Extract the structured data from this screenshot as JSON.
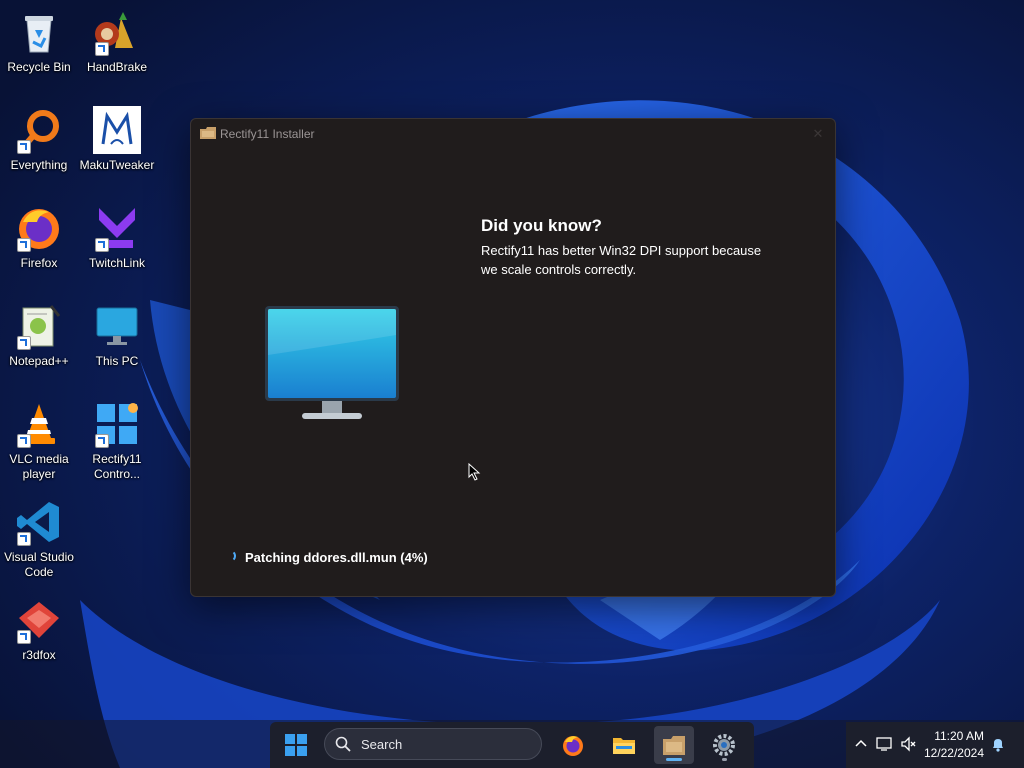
{
  "desktop": {
    "icons": [
      {
        "label": "Recycle Bin",
        "icon": "recycle-bin-icon"
      },
      {
        "label": "HandBrake",
        "icon": "handbrake-icon"
      },
      {
        "label": "Everything",
        "icon": "everything-icon"
      },
      {
        "label": "MakuTweaker",
        "icon": "makutweaker-icon"
      },
      {
        "label": "Firefox",
        "icon": "firefox-icon"
      },
      {
        "label": "TwitchLink",
        "icon": "twitchlink-icon"
      },
      {
        "label": "Notepad++",
        "icon": "notepadpp-icon"
      },
      {
        "label": "This PC",
        "icon": "this-pc-icon"
      },
      {
        "label": "VLC media player",
        "icon": "vlc-icon"
      },
      {
        "label": "Rectify11 Contro...",
        "icon": "rectify11-control-icon"
      },
      {
        "label": "Visual Studio Code",
        "icon": "vscode-icon"
      },
      {
        "label": "r3dfox",
        "icon": "r3dfox-icon"
      }
    ]
  },
  "installer": {
    "title": "Rectify11 Installer",
    "tip_title": "Did you know?",
    "tip_body": "Rectify11 has better Win32 DPI support because we scale controls correctly.",
    "status": "Patching ddores.dll.mun (4%)",
    "progress_percent": 4,
    "close_icon": "close-icon"
  },
  "taskbar": {
    "search_placeholder": "Search",
    "apps": [
      "start-icon",
      "firefox-icon",
      "file-explorer-icon",
      "rectify11-installer-icon",
      "settings-icon"
    ],
    "active_app": "rectify11-installer-icon"
  },
  "tray": {
    "time": "11:20 AM",
    "date": "12/22/2024",
    "icons": [
      "chevron-up-icon",
      "network-icon",
      "volume-muted-icon",
      "notification-bell-icon"
    ]
  },
  "colors": {
    "window_bg": "#201c1c",
    "accent": "#5fb2f2",
    "taskbar_bg": "#1c1f2c"
  }
}
